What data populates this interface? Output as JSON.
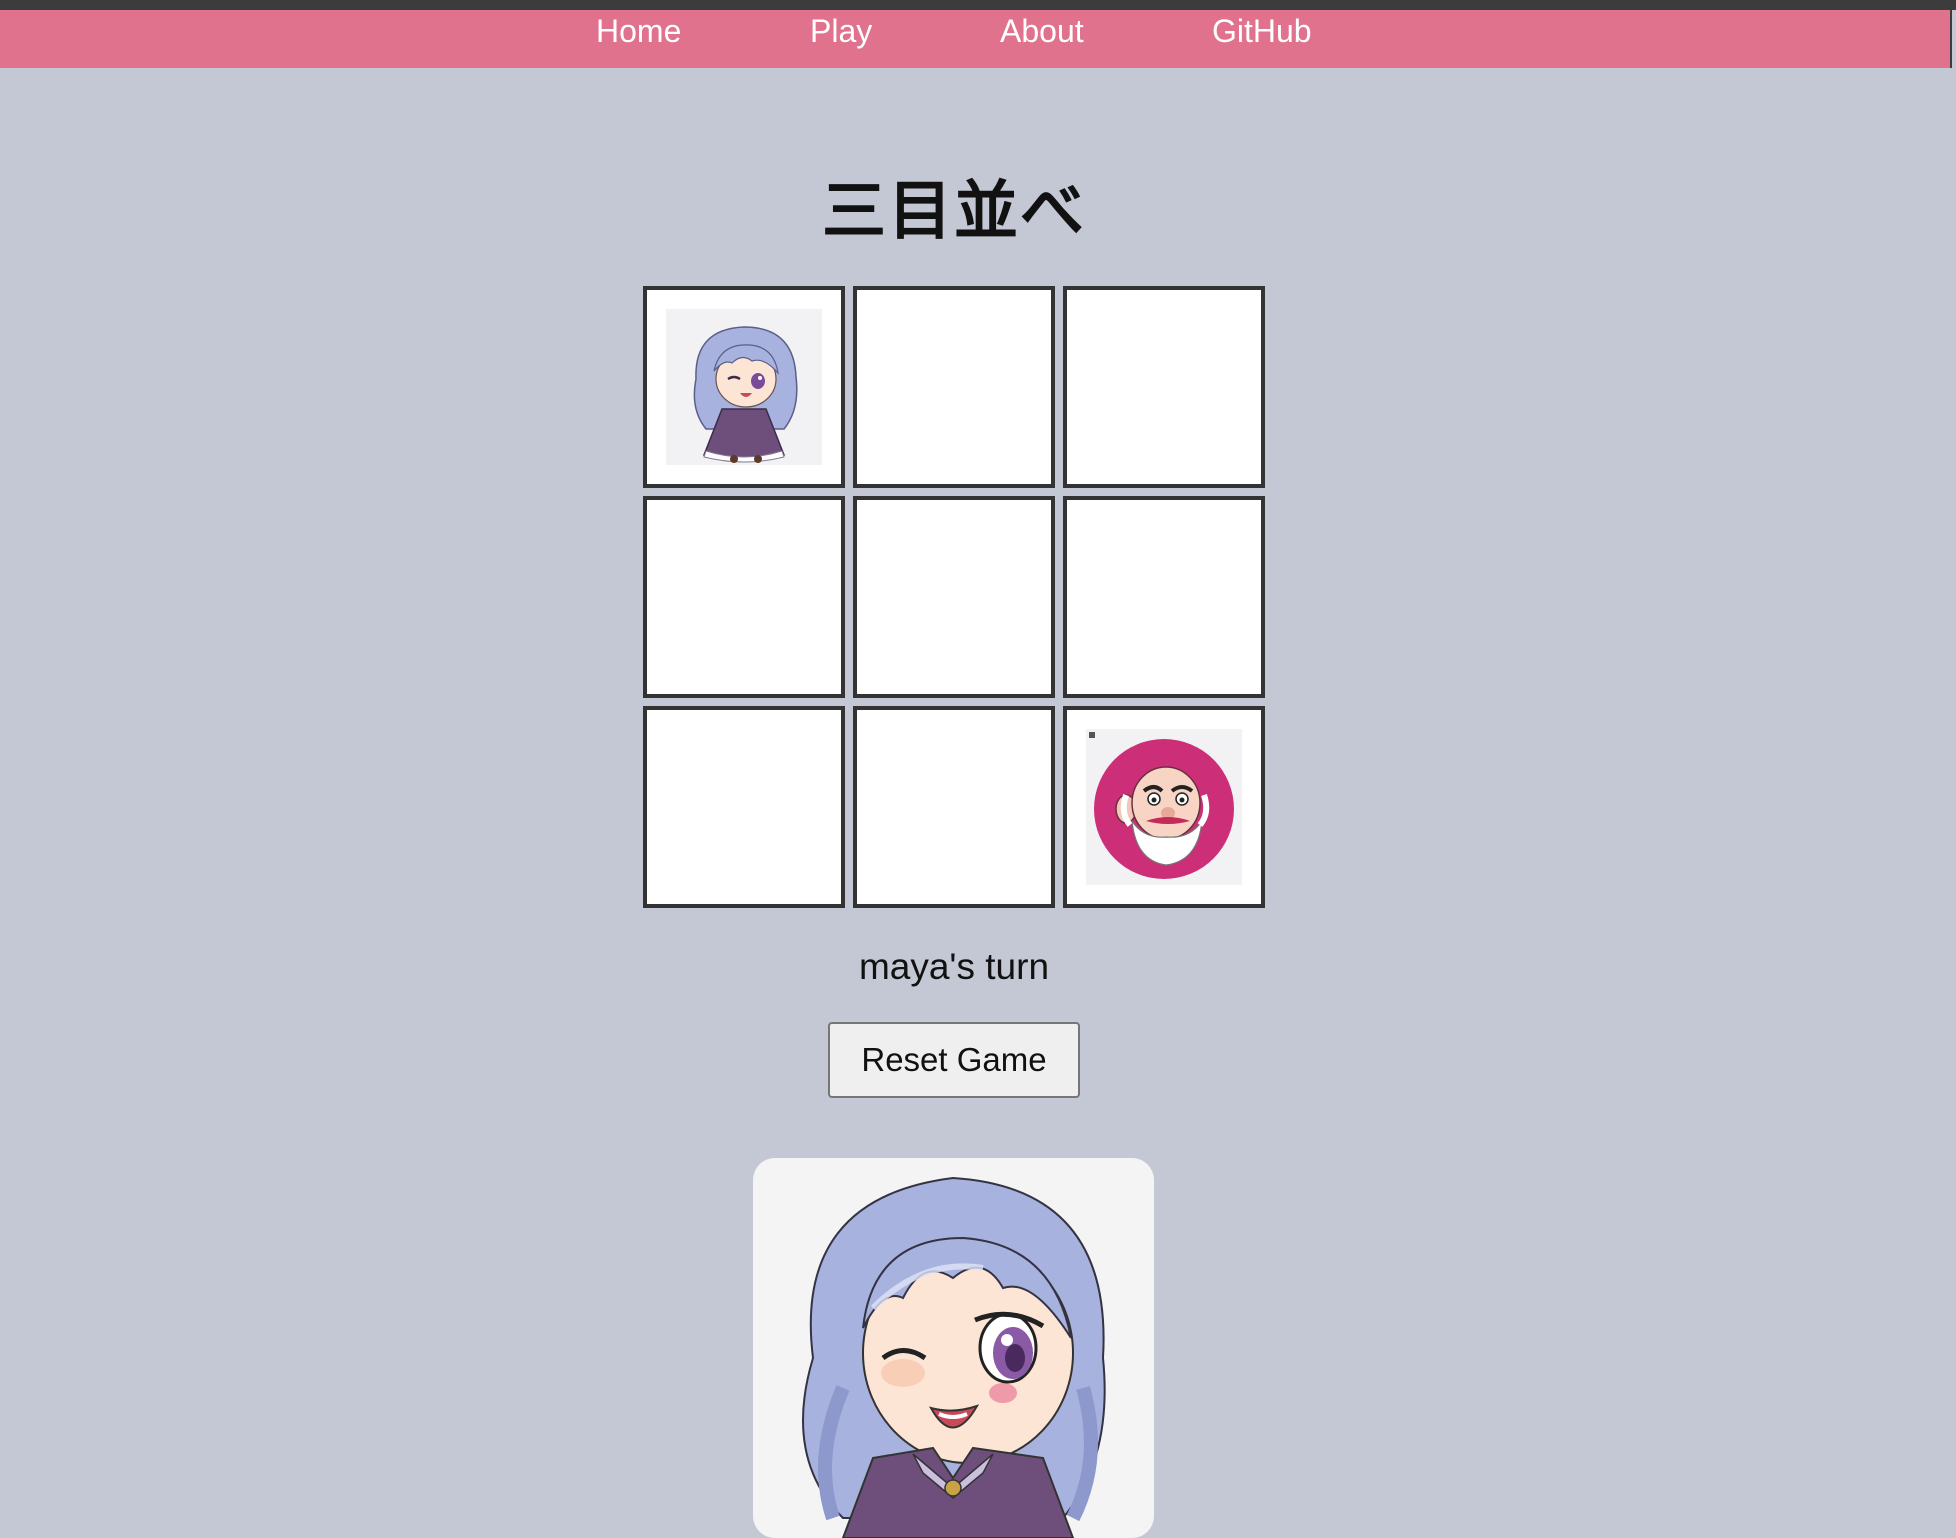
{
  "nav": {
    "items": [
      {
        "label": "Home"
      },
      {
        "label": "Play"
      },
      {
        "label": "About"
      },
      {
        "label": "GitHub"
      }
    ]
  },
  "game": {
    "title": "三目並べ",
    "board": [
      [
        "maya",
        "",
        ""
      ],
      [
        "",
        "",
        ""
      ],
      [
        "",
        "",
        "old-man"
      ]
    ],
    "status": "maya's turn",
    "reset_label": "Reset Game",
    "current_player": "maya"
  },
  "colors": {
    "page_background": "#c3c8d4",
    "navbar": "#e0728e",
    "cell_border": "#333333",
    "maya_hair": "#a8b2de",
    "maya_dress": "#6e4f7c",
    "opponent_badge": "#cc2f78"
  },
  "icons": {
    "maya_piece": "anime-girl-piece-icon",
    "opponent_piece": "bearded-old-man-piece-icon",
    "current_player_portrait": "anime-girl-portrait"
  }
}
